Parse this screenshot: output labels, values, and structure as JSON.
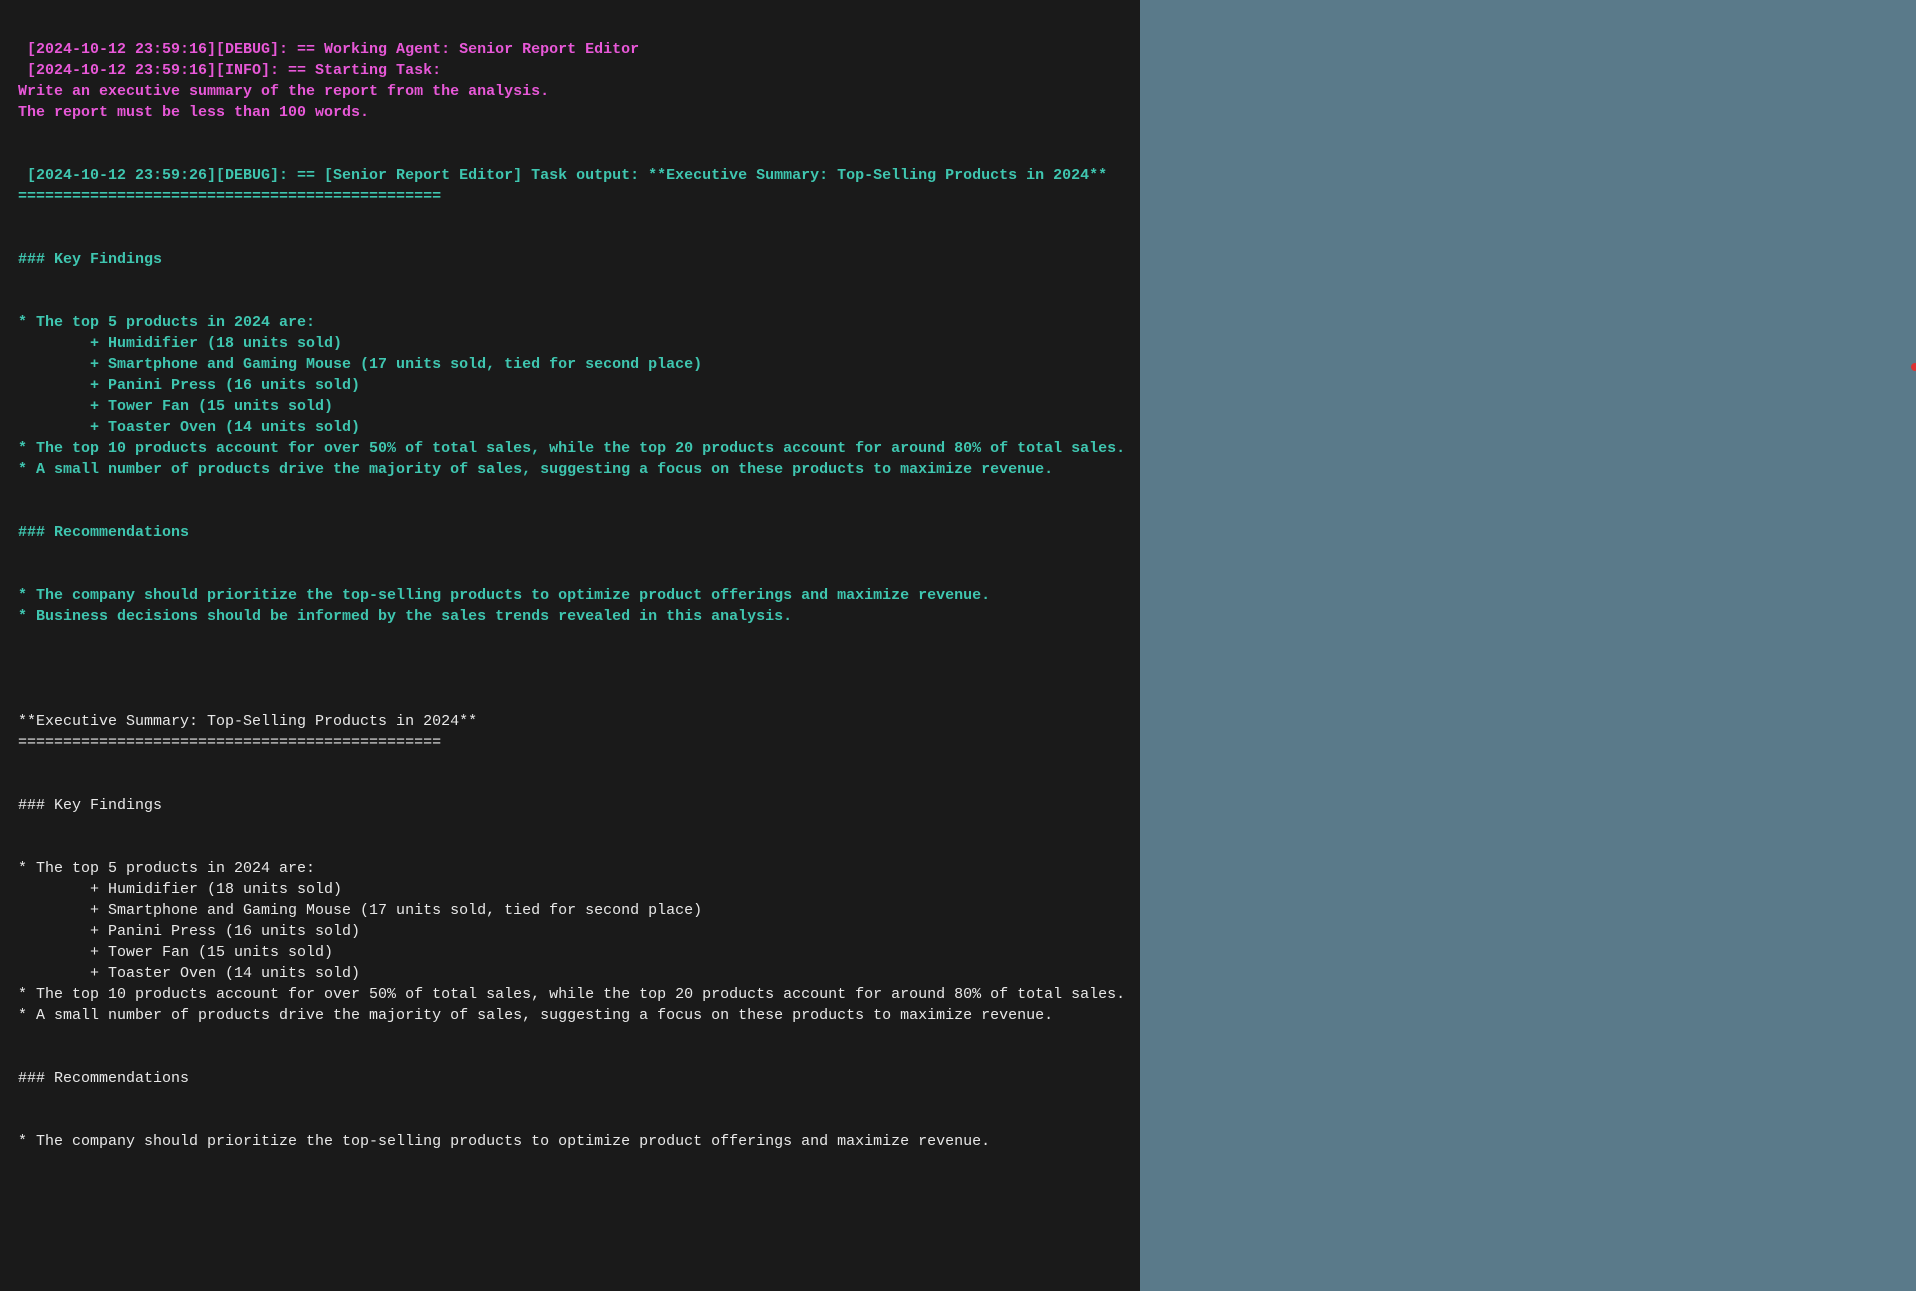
{
  "log": {
    "line1": " [2024-10-12 23:59:16][DEBUG]: == Working Agent: Senior Report Editor",
    "line2": " [2024-10-12 23:59:16][INFO]: == Starting Task:",
    "line3": "Write an executive summary of the report from the analysis.",
    "line4": "The report must be less than 100 words.",
    "line5": " [2024-10-12 23:59:26][DEBUG]: == [Senior Report Editor] Task output: **Executive Summary: Top-Selling Products in 2024**",
    "line6": "===============================================",
    "line7": "### Key Findings",
    "line8": "* The top 5 products in 2024 are:",
    "line9": "        + Humidifier (18 units sold)",
    "line10": "        + Smartphone and Gaming Mouse (17 units sold, tied for second place)",
    "line11": "        + Panini Press (16 units sold)",
    "line12": "        + Tower Fan (15 units sold)",
    "line13": "        + Toaster Oven (14 units sold)",
    "line14": "* The top 10 products account for over 50% of total sales, while the top 20 products account for around 80% of total sales.",
    "line15": "* A small number of products drive the majority of sales, suggesting a focus on these products to maximize revenue.",
    "line16": "### Recommendations",
    "line17": "* The company should prioritize the top-selling products to optimize product offerings and maximize revenue.",
    "line18": "* Business decisions should be informed by the sales trends revealed in this analysis.",
    "line19": "**Executive Summary: Top-Selling Products in 2024**",
    "line20": "===============================================",
    "line21": "### Key Findings",
    "line22": "* The top 5 products in 2024 are:",
    "line23": "        + Humidifier (18 units sold)",
    "line24": "        + Smartphone and Gaming Mouse (17 units sold, tied for second place)",
    "line25": "        + Panini Press (16 units sold)",
    "line26": "        + Tower Fan (15 units sold)",
    "line27": "        + Toaster Oven (14 units sold)",
    "line28": "* The top 10 products account for over 50% of total sales, while the top 20 products account for around 80% of total sales.",
    "line29": "* A small number of products drive the majority of sales, suggesting a focus on these products to maximize revenue.",
    "line30": "### Recommendations",
    "line31": "* The company should prioritize the top-selling products to optimize product offerings and maximize revenue."
  }
}
